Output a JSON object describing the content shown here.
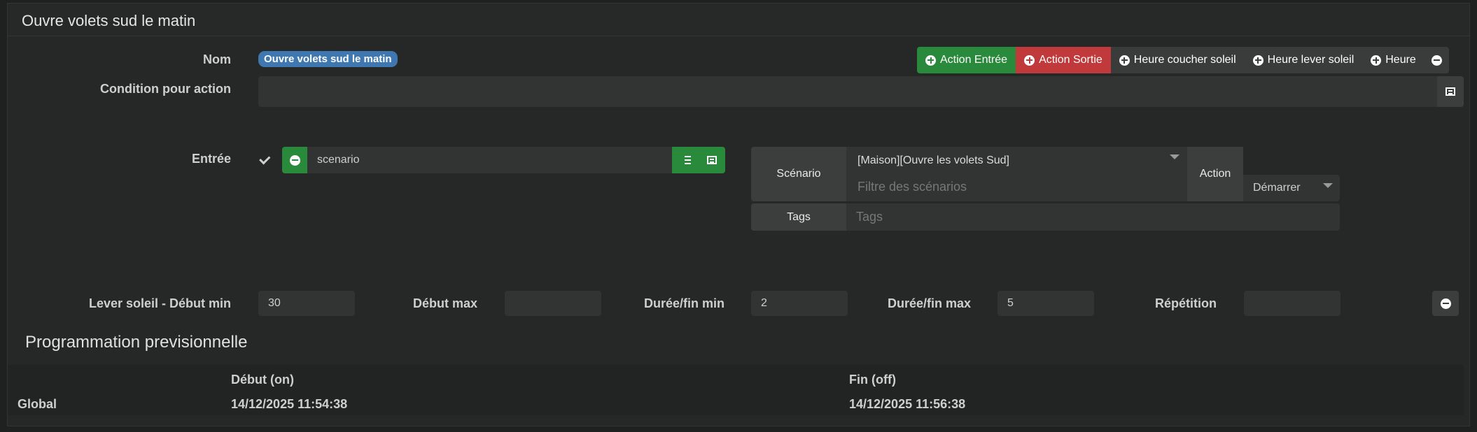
{
  "panel": {
    "title": "Ouvre volets sud le matin"
  },
  "form": {
    "name_label": "Nom",
    "name_value": "Ouvre volets sud le matin",
    "condition_label": "Condition pour action",
    "condition_value": "",
    "entry_label": "Entrée",
    "entry_checked": true,
    "entry_value": "scenario"
  },
  "action_buttons": [
    {
      "label": "Action Entrée",
      "color": "#2a8a3b"
    },
    {
      "label": "Action Sortie",
      "color": "#c0393b"
    },
    {
      "label": "Heure coucher soleil"
    },
    {
      "label": "Heure lever soleil"
    },
    {
      "label": "Heure"
    }
  ],
  "scenario_block": {
    "scenario_label": "Scénario",
    "scenario_selected": "[Maison][Ouvre les volets Sud]",
    "scenario_filter_placeholder": "Filtre des scénarios",
    "action_label": "Action",
    "action_selected": "Démarrer",
    "tags_label": "Tags",
    "tags_placeholder": "Tags"
  },
  "timing": {
    "sunrise_start_min_label": "Lever soleil - Début min",
    "sunrise_start_min_value": "30",
    "start_max_label": "Début max",
    "start_max_value": "",
    "duration_min_label": "Durée/fin min",
    "duration_min_value": "2",
    "duration_max_label": "Durée/fin max",
    "duration_max_value": "5",
    "repetition_label": "Répétition",
    "repetition_value": ""
  },
  "schedule": {
    "title": "Programmation previsionnelle",
    "columns": [
      "Début (on)",
      "Fin (off)"
    ],
    "rows": [
      {
        "label": "Global",
        "start": "14/12/2025 11:54:38",
        "end": "14/12/2025 11:56:38"
      }
    ]
  },
  "colors": {
    "accent_green": "#2a8a3b",
    "accent_red": "#c0393b",
    "badge_blue": "#3f78b1"
  }
}
